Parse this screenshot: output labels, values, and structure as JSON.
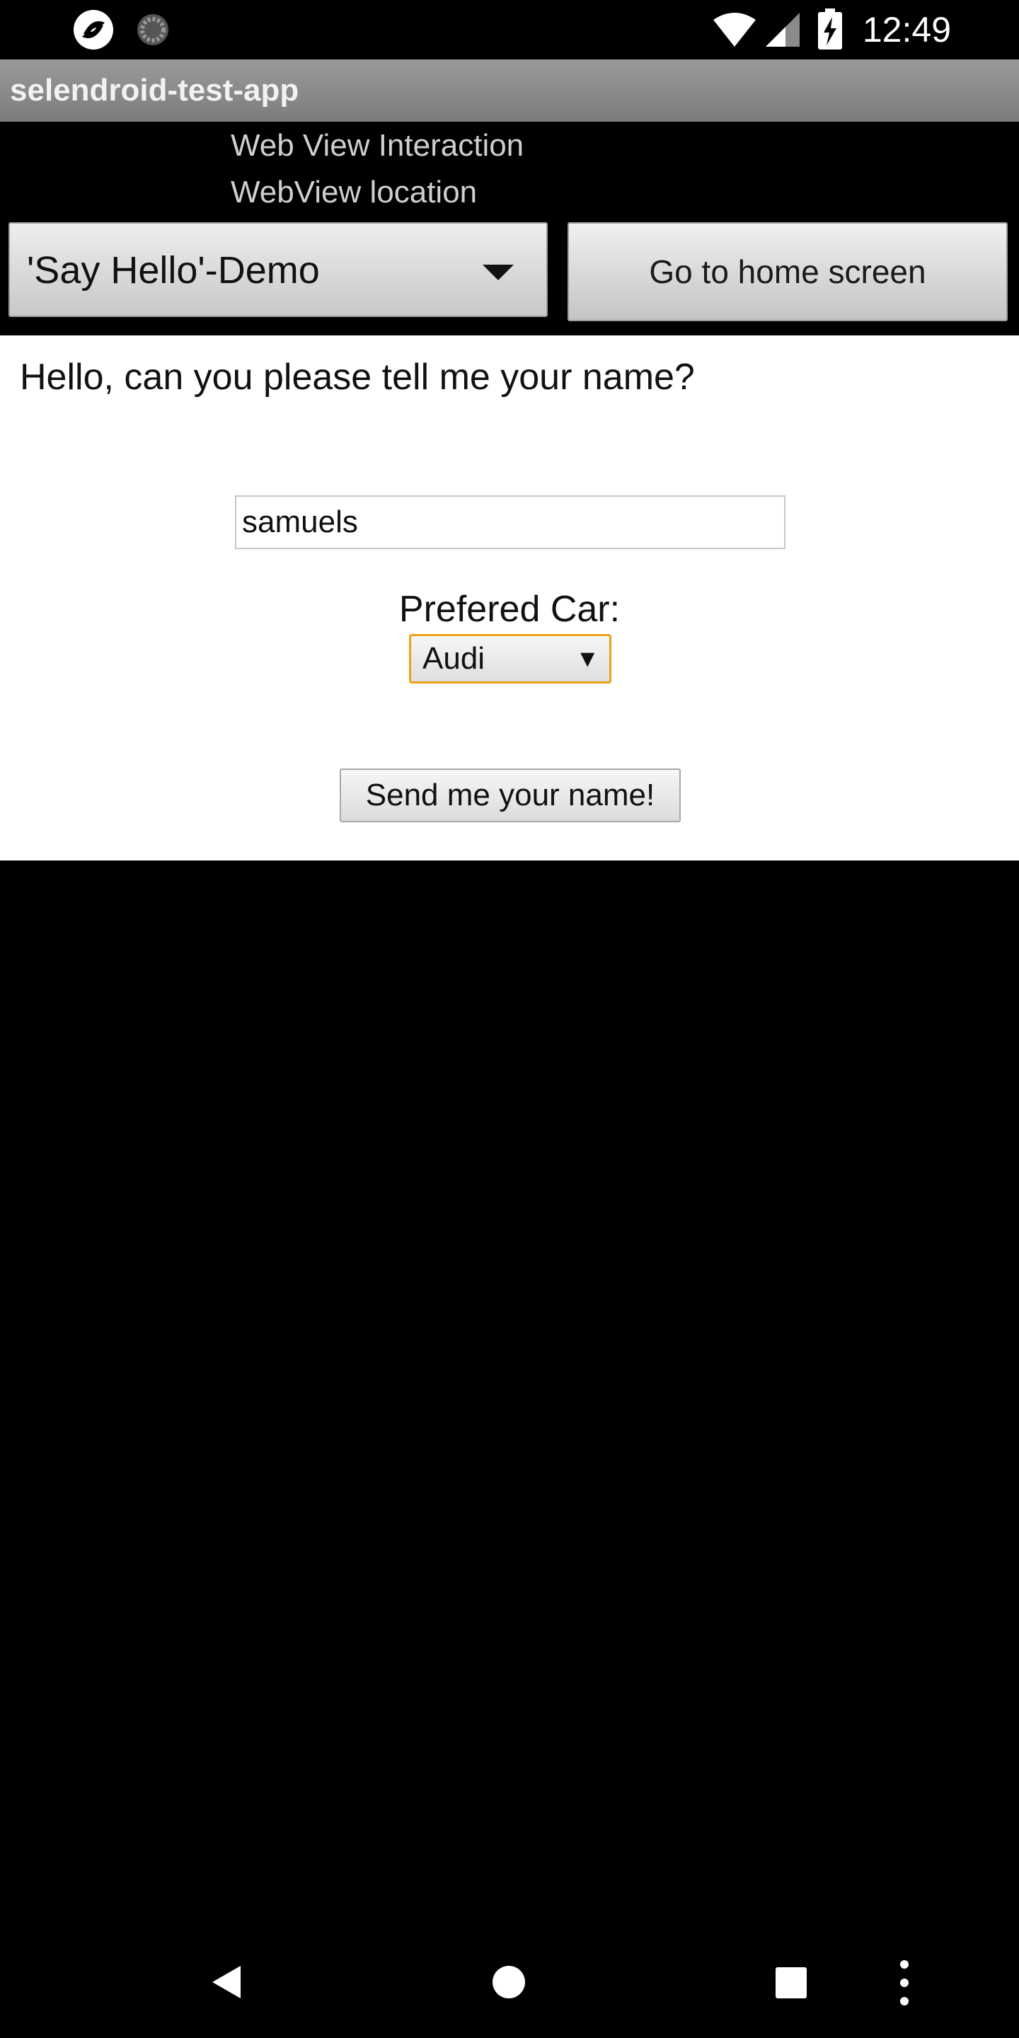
{
  "status_bar": {
    "time": "12:49",
    "icons": [
      "app-notification-icon",
      "sync-icon",
      "wifi-icon",
      "cell-signal-icon",
      "battery-charging-icon"
    ]
  },
  "action_bar": {
    "title": "selendroid-test-app"
  },
  "subtitles": {
    "line1": "Web View Interaction",
    "line2": "WebView location"
  },
  "demo_spinner": {
    "selected": "'Say Hello'-Demo"
  },
  "home_button": {
    "label": "Go to home screen"
  },
  "webview": {
    "question": "Hello, can you please tell me your name?",
    "name_input": {
      "value": "samuels"
    },
    "car_label": "Prefered Car:",
    "car_select": {
      "selected": "Audi",
      "arrow": "▼"
    },
    "send_button": "Send me your name!"
  },
  "nav_bar": {
    "icons": [
      "back-icon",
      "home-icon",
      "recents-icon",
      "more-options-icon"
    ]
  },
  "colors": {
    "focus_border": "#e8a317",
    "action_bar": "#8a8a8a",
    "background": "#000000"
  }
}
